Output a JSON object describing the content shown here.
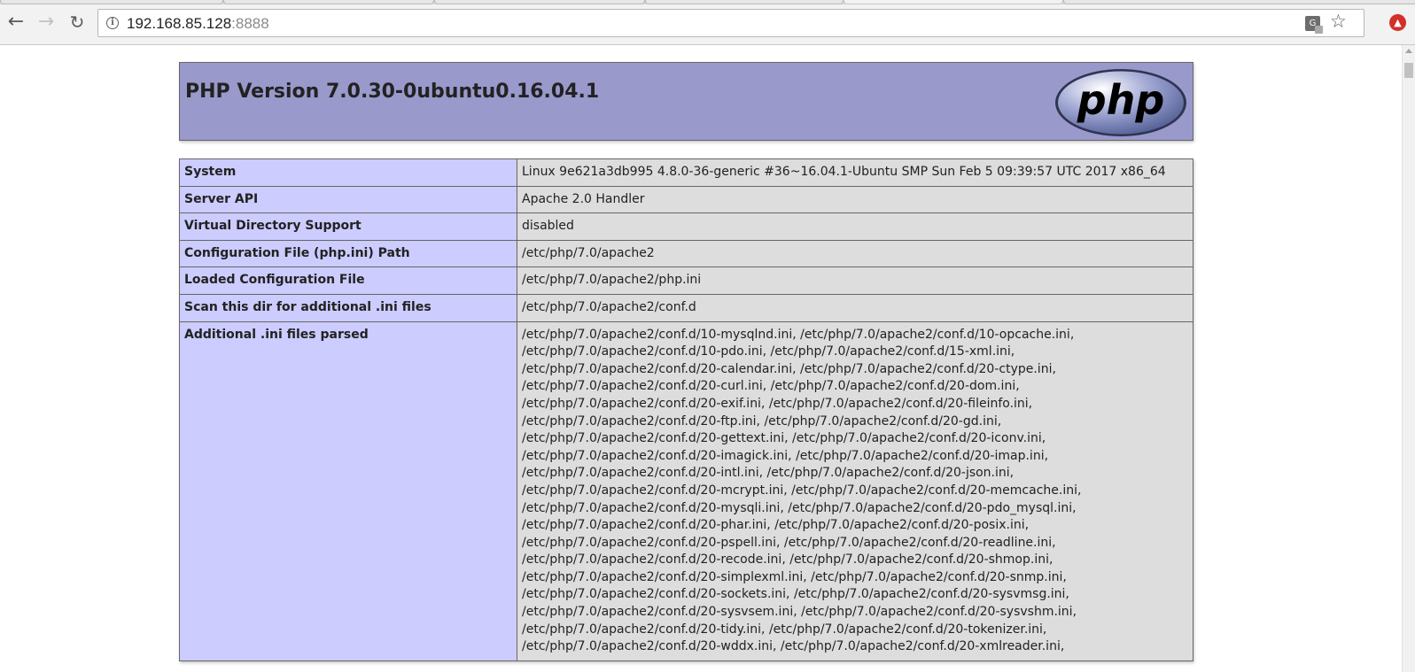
{
  "browser": {
    "back_icon": "back-arrow-icon",
    "forward_icon": "forward-arrow-icon",
    "reload_icon": "reload-icon",
    "address": {
      "host": "192.168.85.128",
      "port": ":8888"
    }
  },
  "phpinfo": {
    "title": "PHP Version 7.0.30-0ubuntu0.16.04.1",
    "logo_text": "php",
    "rows": [
      {
        "label": "System",
        "value": [
          "Linux 9e621a3db995 4.8.0-36-generic #36~16.04.1-Ubuntu SMP Sun Feb 5 09:39:57 UTC 2017 x86_64"
        ]
      },
      {
        "label": "Server API",
        "value": [
          "Apache 2.0 Handler"
        ]
      },
      {
        "label": "Virtual Directory Support",
        "value": [
          "disabled"
        ]
      },
      {
        "label": "Configuration File (php.ini) Path",
        "value": [
          "/etc/php/7.0/apache2"
        ]
      },
      {
        "label": "Loaded Configuration File",
        "value": [
          "/etc/php/7.0/apache2/php.ini"
        ]
      },
      {
        "label": "Scan this dir for additional .ini files",
        "value": [
          "/etc/php/7.0/apache2/conf.d"
        ]
      },
      {
        "label": "Additional .ini files parsed",
        "value": [
          "/etc/php/7.0/apache2/conf.d/10-mysqlnd.ini, /etc/php/7.0/apache2/conf.d/10-opcache.ini,",
          "/etc/php/7.0/apache2/conf.d/10-pdo.ini, /etc/php/7.0/apache2/conf.d/15-xml.ini,",
          "/etc/php/7.0/apache2/conf.d/20-calendar.ini, /etc/php/7.0/apache2/conf.d/20-ctype.ini,",
          "/etc/php/7.0/apache2/conf.d/20-curl.ini, /etc/php/7.0/apache2/conf.d/20-dom.ini,",
          "/etc/php/7.0/apache2/conf.d/20-exif.ini, /etc/php/7.0/apache2/conf.d/20-fileinfo.ini,",
          "/etc/php/7.0/apache2/conf.d/20-ftp.ini, /etc/php/7.0/apache2/conf.d/20-gd.ini,",
          "/etc/php/7.0/apache2/conf.d/20-gettext.ini, /etc/php/7.0/apache2/conf.d/20-iconv.ini,",
          "/etc/php/7.0/apache2/conf.d/20-imagick.ini, /etc/php/7.0/apache2/conf.d/20-imap.ini,",
          "/etc/php/7.0/apache2/conf.d/20-intl.ini, /etc/php/7.0/apache2/conf.d/20-json.ini,",
          "/etc/php/7.0/apache2/conf.d/20-mcrypt.ini, /etc/php/7.0/apache2/conf.d/20-memcache.ini,",
          "/etc/php/7.0/apache2/conf.d/20-mysqli.ini, /etc/php/7.0/apache2/conf.d/20-pdo_mysql.ini,",
          "/etc/php/7.0/apache2/conf.d/20-phar.ini, /etc/php/7.0/apache2/conf.d/20-posix.ini,",
          "/etc/php/7.0/apache2/conf.d/20-pspell.ini, /etc/php/7.0/apache2/conf.d/20-readline.ini,",
          "/etc/php/7.0/apache2/conf.d/20-recode.ini, /etc/php/7.0/apache2/conf.d/20-shmop.ini,",
          "/etc/php/7.0/apache2/conf.d/20-simplexml.ini, /etc/php/7.0/apache2/conf.d/20-snmp.ini,",
          "/etc/php/7.0/apache2/conf.d/20-sockets.ini, /etc/php/7.0/apache2/conf.d/20-sysvmsg.ini,",
          "/etc/php/7.0/apache2/conf.d/20-sysvsem.ini, /etc/php/7.0/apache2/conf.d/20-sysvshm.ini,",
          "/etc/php/7.0/apache2/conf.d/20-tidy.ini, /etc/php/7.0/apache2/conf.d/20-tokenizer.ini,",
          "/etc/php/7.0/apache2/conf.d/20-wddx.ini, /etc/php/7.0/apache2/conf.d/20-xmlreader.ini,"
        ]
      }
    ]
  },
  "colors": {
    "header_bg": "#9999cc",
    "label_bg": "#ccccff",
    "value_bg": "#dddddd",
    "border": "#666666"
  }
}
